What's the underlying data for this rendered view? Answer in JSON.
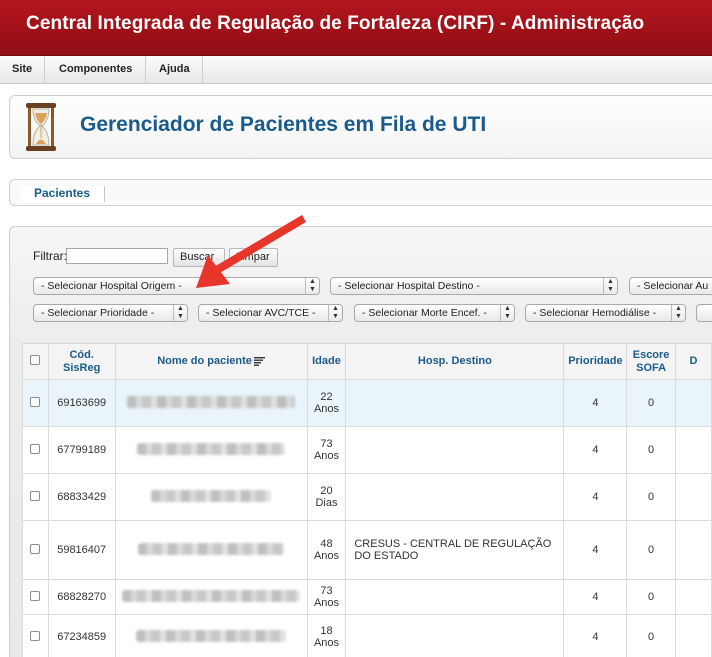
{
  "app": {
    "title": "Central Integrada de Regulação de Fortaleza (CIRF) - Administração"
  },
  "menu": {
    "items": [
      {
        "label": "Site"
      },
      {
        "label": "Componentes"
      },
      {
        "label": "Ajuda"
      }
    ]
  },
  "page": {
    "title": "Gerenciador de Pacientes em Fila de UTI",
    "icon": "hourglass-icon"
  },
  "tabs": [
    {
      "label": "Pacientes"
    }
  ],
  "filter": {
    "label": "Filtrar:",
    "value": "",
    "search_button": "Buscar",
    "clear_button": "Limpar",
    "selects_row1": [
      {
        "value": "- Selecionar Hospital Origem -"
      },
      {
        "value": "- Selecionar Hospital Destino -"
      },
      {
        "value": "- Selecionar Au"
      }
    ],
    "selects_row2": [
      {
        "value": "- Selecionar Prioridade -"
      },
      {
        "value": "- Selecionar AVC/TCE -"
      },
      {
        "value": "- Selecionar Morte Encef. -"
      },
      {
        "value": "- Selecionar Hemodiálise -"
      }
    ]
  },
  "table": {
    "columns": {
      "cod_line1": "Cód.",
      "cod_line2": "SisReg",
      "nome": "Nome do paciente",
      "idade": "Idade",
      "destino": "Hosp. Destino",
      "prioridade": "Prioridade",
      "escore_line1": "Escore",
      "escore_line2": "SOFA",
      "last": "D"
    },
    "rows": [
      {
        "cod": "69163699",
        "idade_n": "22",
        "idade_u": "Anos",
        "destino": "",
        "prioridade": "4",
        "sofa": "0"
      },
      {
        "cod": "67799189",
        "idade_n": "73",
        "idade_u": "Anos",
        "destino": "",
        "prioridade": "4",
        "sofa": "0"
      },
      {
        "cod": "68833429",
        "idade_n": "20",
        "idade_u": "Dias",
        "destino": "",
        "prioridade": "4",
        "sofa": "0"
      },
      {
        "cod": "59816407",
        "idade_n": "48",
        "idade_u": "Anos",
        "destino": "CRESUS - CENTRAL DE REGULAÇÃO DO ESTADO",
        "prioridade": "4",
        "sofa": "0"
      },
      {
        "cod": "68828270",
        "idade_n": "73",
        "idade_u": "Anos",
        "destino": "",
        "prioridade": "4",
        "sofa": "0"
      },
      {
        "cod": "67234859",
        "idade_n": "18",
        "idade_u": "Anos",
        "destino": "",
        "prioridade": "4",
        "sofa": "0"
      }
    ]
  },
  "colors": {
    "title_bar": "#a3121a",
    "link_blue": "#1b5b8c",
    "highlight_row": "#e9f4fb",
    "annotation_arrow": "#e8352a"
  }
}
